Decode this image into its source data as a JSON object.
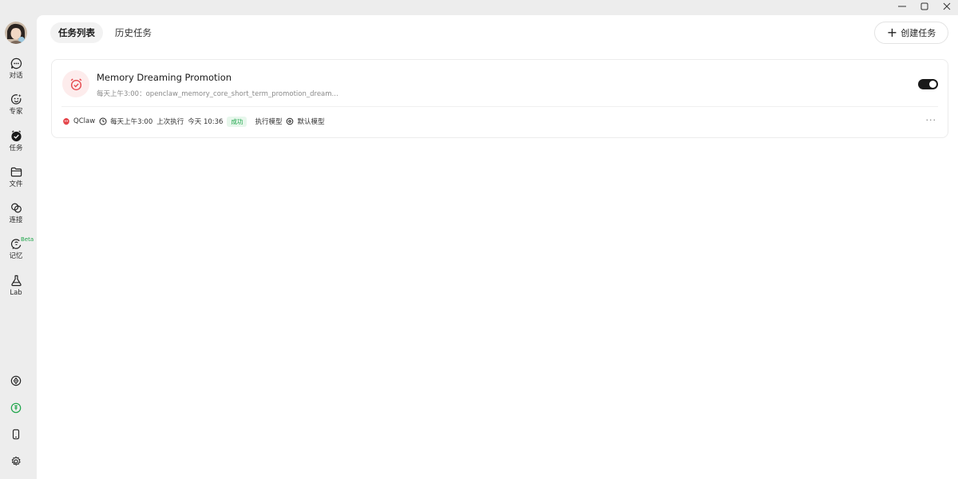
{
  "sidebar": {
    "items": [
      {
        "label": "对话",
        "icon": "chat-icon"
      },
      {
        "label": "专家",
        "icon": "expert-icon"
      },
      {
        "label": "任务",
        "icon": "task-icon"
      },
      {
        "label": "文件",
        "icon": "folder-icon"
      },
      {
        "label": "连接",
        "icon": "link-icon"
      },
      {
        "label": "记忆",
        "icon": "memory-icon",
        "badge": "Beta"
      },
      {
        "label": "Lab",
        "icon": "flask-icon"
      }
    ],
    "bottom_icons": [
      "compass-icon",
      "credits-icon",
      "phone-icon",
      "settings-icon"
    ]
  },
  "tabs": [
    {
      "label": "任务列表",
      "active": true
    },
    {
      "label": "历史任务",
      "active": false
    }
  ],
  "create_button": {
    "label": "创建任务"
  },
  "tasks": [
    {
      "title": "Memory Dreaming Promotion",
      "schedule_prefix": "每天上午3:00：",
      "command": "openclaw_memory_core_short_term_promotion_dream...",
      "enabled": true,
      "agent": "QClaw",
      "schedule": "每天上午3:00",
      "last_run_label": "上次执行",
      "last_run_time": "今天 10:36",
      "status": "成功",
      "model_label": "执行模型",
      "model": "默认模型",
      "more": "···"
    }
  ],
  "colors": {
    "accent_red": "#e5484d",
    "success_green": "#1ea54a",
    "toggle_on": "#1a1a1a"
  }
}
